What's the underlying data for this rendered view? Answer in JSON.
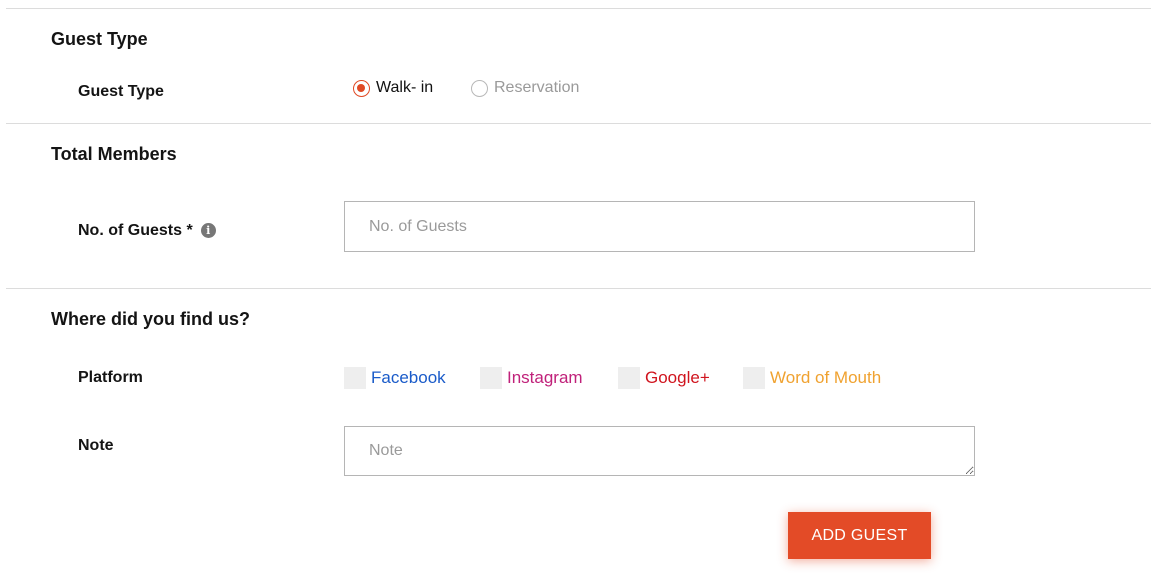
{
  "sections": {
    "guest_type": {
      "title": "Guest Type",
      "field_label": "Guest Type",
      "options": [
        {
          "label": "Walk- in",
          "checked": true
        },
        {
          "label": "Reservation",
          "checked": false
        }
      ]
    },
    "total_members": {
      "title": "Total Members",
      "field_label": "No. of Guests *",
      "info_icon": "info-icon",
      "input_placeholder": "No. of Guests",
      "input_value": ""
    },
    "find_us": {
      "title": "Where did you find us?",
      "platform_label": "Platform",
      "platforms": [
        {
          "label": "Facebook",
          "color": "#1a5bc9",
          "checked": false
        },
        {
          "label": "Instagram",
          "color": "#c0217a",
          "checked": false
        },
        {
          "label": "Google+",
          "color": "#d0141e",
          "checked": false
        },
        {
          "label": "Word of Mouth",
          "color": "#f0a230",
          "checked": false
        }
      ],
      "note_label": "Note",
      "note_placeholder": "Note",
      "note_value": ""
    }
  },
  "actions": {
    "add_guest_label": "ADD GUEST"
  },
  "colors": {
    "accent": "#e34b27",
    "divider": "#dcdcdc"
  }
}
